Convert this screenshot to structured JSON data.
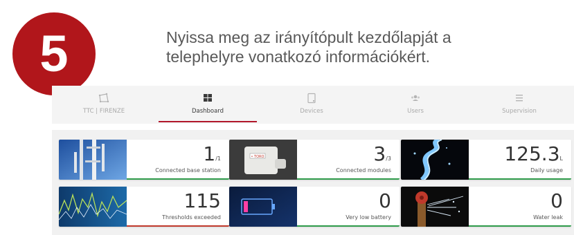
{
  "step": {
    "number": "5",
    "instruction_line1": "Nyissa meg az irányítópult kezdőlapját a",
    "instruction_line2": "telephelyre vonatkozó információkért."
  },
  "colors": {
    "badge": "#b1161b",
    "active_tab": "#b1162a",
    "red_accent": "#c0392b",
    "green_accent": "#2e9b4a"
  },
  "nav": {
    "items": [
      {
        "label": "TTC | FIRENZE",
        "icon": "site-polygon-icon",
        "active": false
      },
      {
        "label": "Dashboard",
        "icon": "dashboard-grid-icon",
        "active": true
      },
      {
        "label": "Devices",
        "icon": "device-tablet-icon",
        "active": false
      },
      {
        "label": "Users",
        "icon": "users-icon",
        "active": false
      },
      {
        "label": "Supervision",
        "icon": "supervision-lines-icon",
        "active": false
      }
    ]
  },
  "cards": [
    {
      "value": "1",
      "sub": "/1",
      "label": "Connected base station",
      "image": "antenna-tower-photo"
    },
    {
      "value": "3",
      "sub": "/3",
      "label": "Connected modules",
      "image": "toro-module-photo"
    },
    {
      "value": "125.3",
      "sub": "L",
      "label": "Daily usage",
      "image": "water-splash-photo"
    },
    {
      "value": "115",
      "sub": "",
      "label": "Thresholds exceeded",
      "image": "line-graph-photo"
    },
    {
      "value": "0",
      "sub": "",
      "label": "Very low battery",
      "image": "low-battery-photo"
    },
    {
      "value": "0",
      "sub": "",
      "label": "Water leak",
      "image": "valve-leak-photo"
    }
  ]
}
